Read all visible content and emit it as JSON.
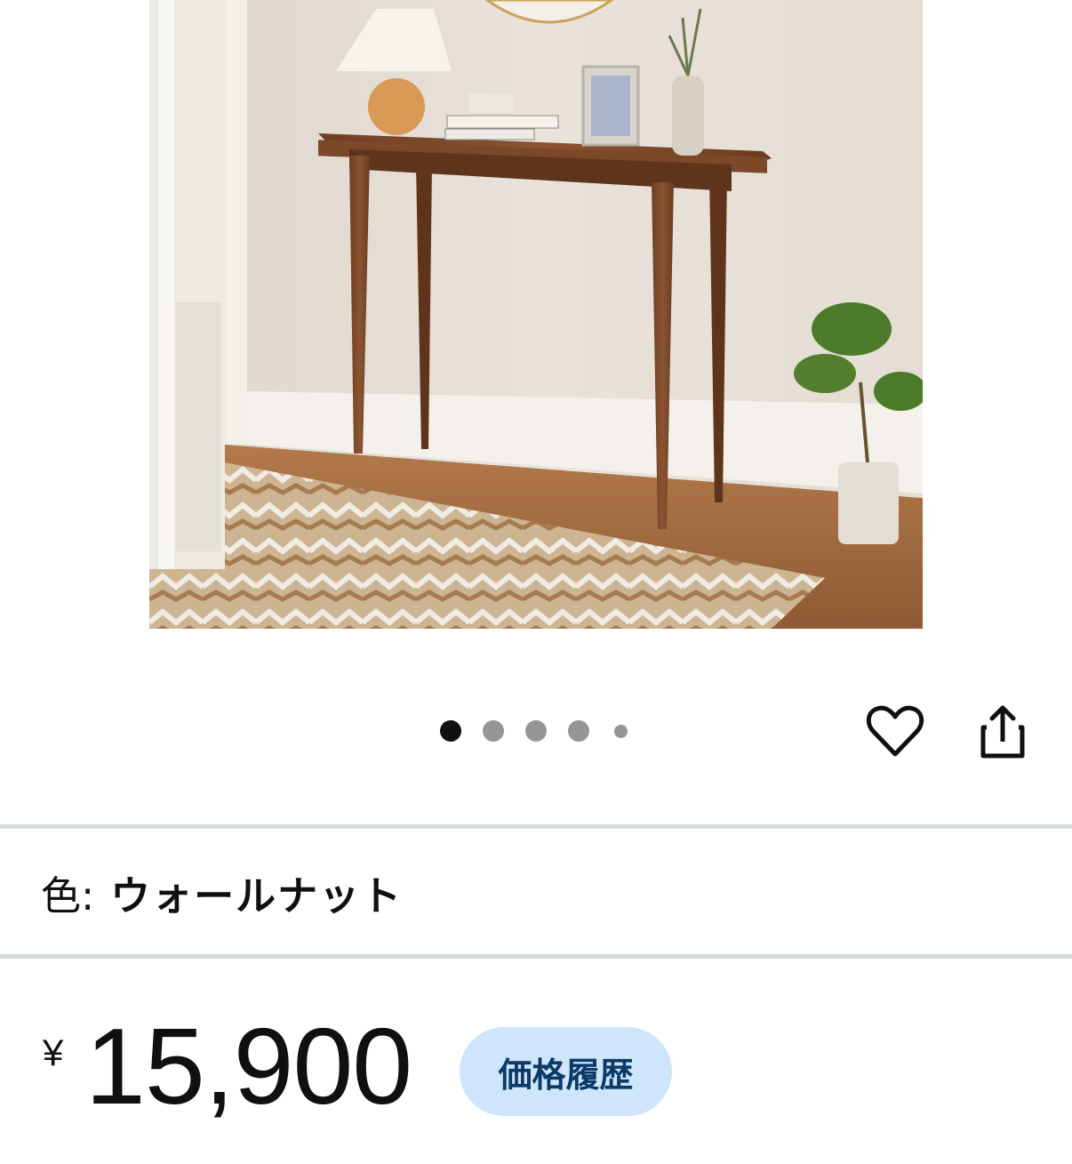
{
  "product": {
    "image_alt": "ウォールナット コンソールテーブル"
  },
  "carousel": {
    "total_dots": 5,
    "active_index": 0
  },
  "actions": {
    "wishlist_icon": "heart-icon",
    "share_icon": "share-icon"
  },
  "variation": {
    "color_label": "色:",
    "color_value": "ウォールナット"
  },
  "pricing": {
    "currency": "¥",
    "price": "15,900",
    "history_button": "価格履歴"
  },
  "colors": {
    "text": "#0f1111",
    "separator": "#d5dbdb",
    "history_bg": "#cfe5fb",
    "history_text": "#0a3a66",
    "dot_active": "#0f0f0f",
    "dot_inactive": "#959595"
  }
}
